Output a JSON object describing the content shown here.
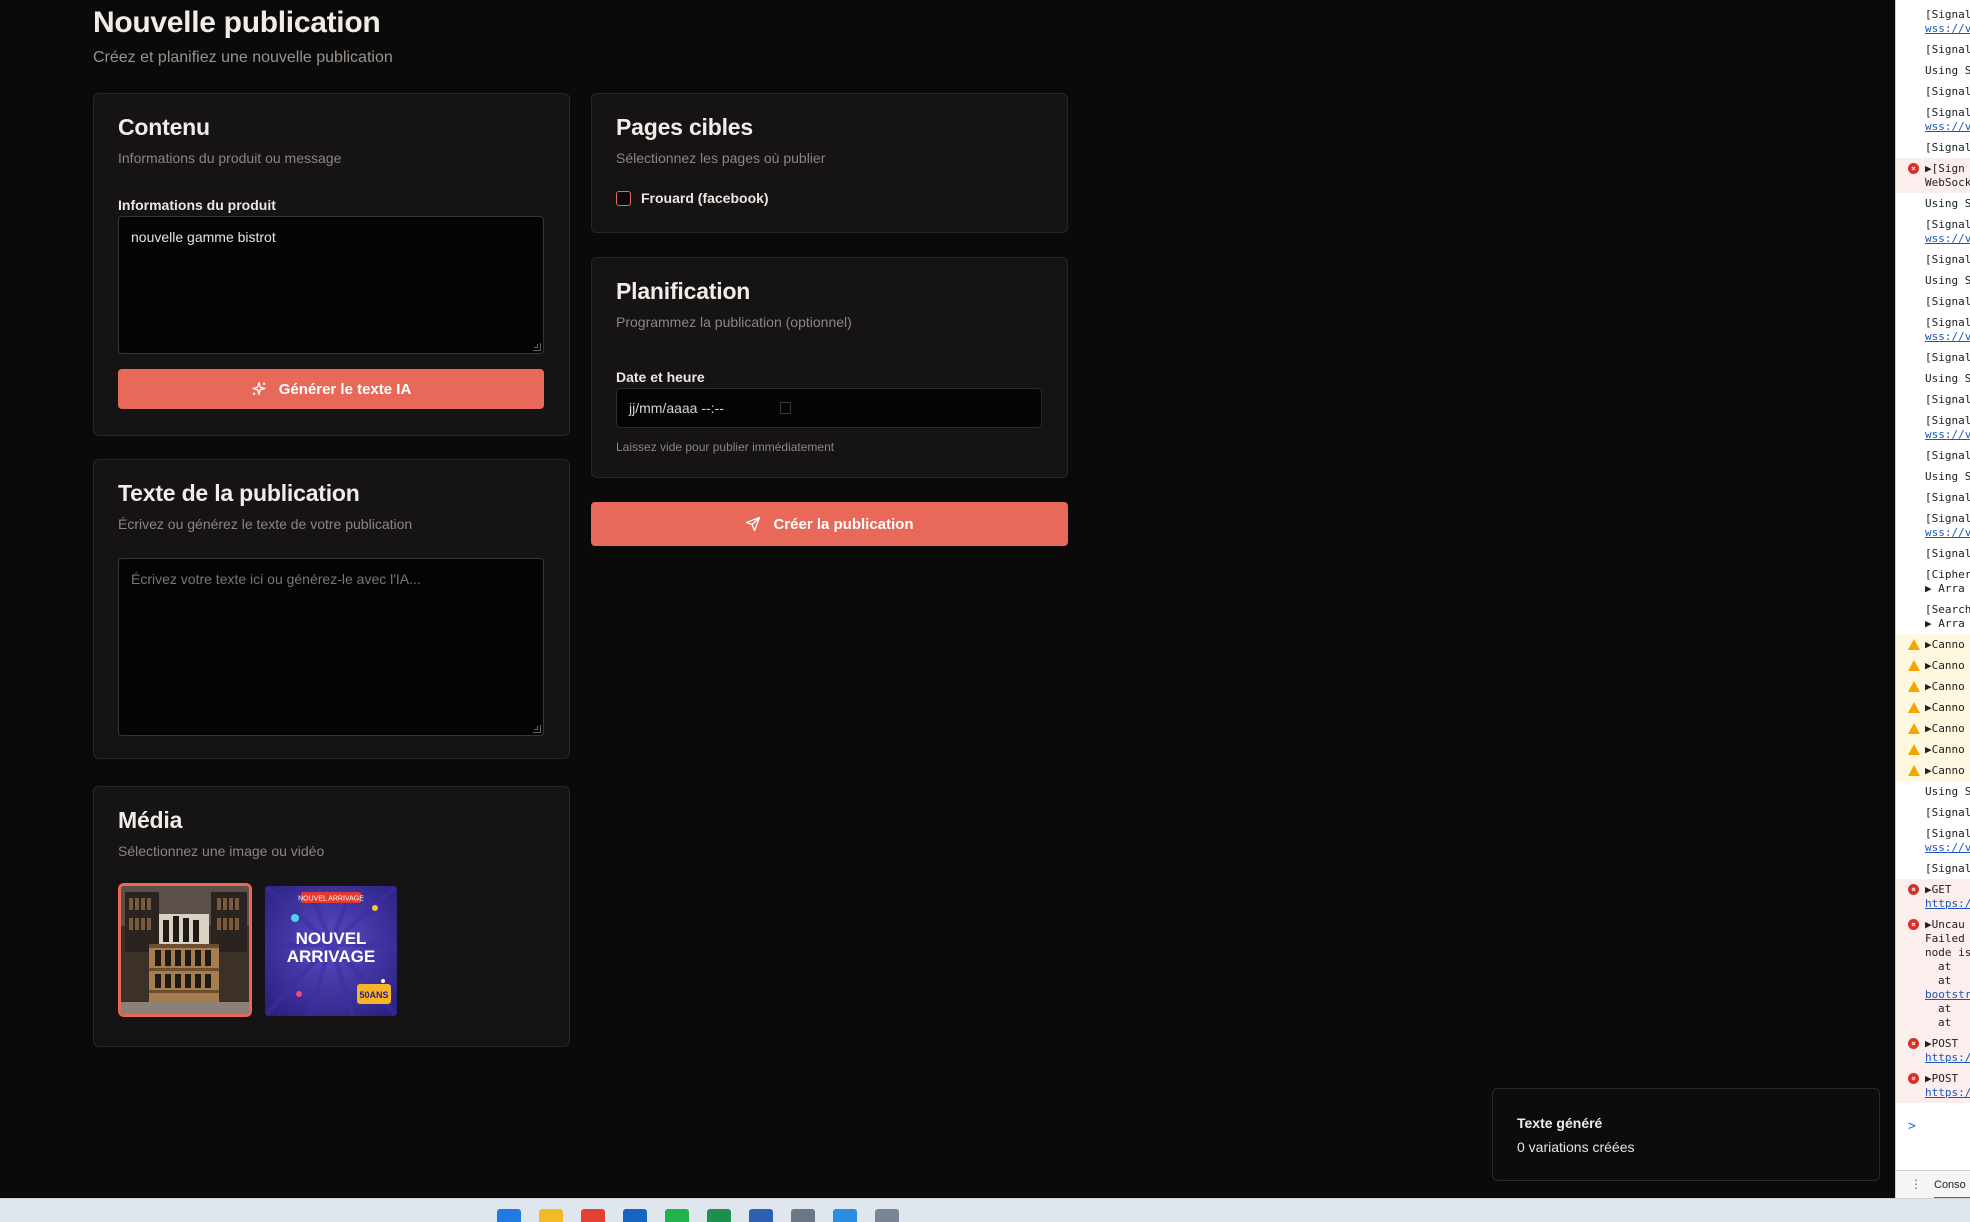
{
  "page": {
    "title": "Nouvelle publication",
    "subtitle": "Créez et planifiez une nouvelle publication"
  },
  "content_card": {
    "title": "Contenu",
    "subtitle": "Informations du produit ou message",
    "field_label": "Informations du produit",
    "field_value": "nouvelle gamme bistrot",
    "generate_button": "Générer le texte IA"
  },
  "text_card": {
    "title": "Texte de la publication",
    "subtitle": "Écrivez ou générez le texte de votre publication",
    "placeholder": "Écrivez votre texte ici ou générez-le avec l'IA..."
  },
  "media_card": {
    "title": "Média",
    "subtitle": "Sélectionnez une image ou vidéo",
    "thumbnails": [
      {
        "name": "store-display-photo",
        "selected": true
      },
      {
        "name": "nouvel-arrivage-poster",
        "selected": false,
        "text_main": "NOUVEL ARRIVAGE",
        "text_banner": "NOUVEL ARRIVAGE",
        "text_badge": "50ANS"
      }
    ]
  },
  "pages_card": {
    "title": "Pages cibles",
    "subtitle": "Sélectionnez les pages où publier",
    "pages": [
      {
        "label": "Frouard (facebook)",
        "checked": false
      }
    ]
  },
  "schedule_card": {
    "title": "Planification",
    "subtitle": "Programmez la publication (optionnel)",
    "field_label": "Date et heure",
    "date_placeholder": "jj/mm/aaaa --:--",
    "hint": "Laissez vide pour publier immédiatement"
  },
  "create_button": "Créer la publication",
  "toast": {
    "title": "Texte généré",
    "description": "0 variations créées"
  },
  "devtools": {
    "lines": [
      {
        "kind": "info",
        "text": "[Signal",
        "sub": "wss://v"
      },
      {
        "kind": "info",
        "text": "[Signal"
      },
      {
        "kind": "info",
        "text": "Using S"
      },
      {
        "kind": "info",
        "text": "[Signal"
      },
      {
        "kind": "info",
        "text": "[Signal",
        "sub": "wss://v"
      },
      {
        "kind": "info",
        "text": "[Signal"
      },
      {
        "kind": "error",
        "text": "▶[Sign",
        "sub": "WebSock"
      },
      {
        "kind": "info",
        "text": "Using S"
      },
      {
        "kind": "info",
        "text": "[Signal",
        "sub": "wss://v"
      },
      {
        "kind": "info",
        "text": "[Signal"
      },
      {
        "kind": "info",
        "text": "Using S"
      },
      {
        "kind": "info",
        "text": "[Signal"
      },
      {
        "kind": "info",
        "text": "[Signal",
        "sub": "wss://v"
      },
      {
        "kind": "info",
        "text": "[Signal"
      },
      {
        "kind": "info",
        "text": "Using S"
      },
      {
        "kind": "info",
        "text": "[Signal"
      },
      {
        "kind": "info",
        "text": "[Signal",
        "sub": "wss://v"
      },
      {
        "kind": "info",
        "text": "[Signal"
      },
      {
        "kind": "info",
        "text": "Using S"
      },
      {
        "kind": "info",
        "text": "[Signal"
      },
      {
        "kind": "info",
        "text": "[Signal",
        "sub": "wss://v"
      },
      {
        "kind": "info",
        "text": "[Signal"
      },
      {
        "kind": "info",
        "text": "[Cipher",
        "sub": "▶ Arra"
      },
      {
        "kind": "info",
        "text": "[Search",
        "sub": "▶ Arra"
      },
      {
        "kind": "warn",
        "text": "▶Canno"
      },
      {
        "kind": "warn",
        "text": "▶Canno"
      },
      {
        "kind": "warn",
        "text": "▶Canno"
      },
      {
        "kind": "warn",
        "text": "▶Canno"
      },
      {
        "kind": "warn",
        "text": "▶Canno"
      },
      {
        "kind": "warn",
        "text": "▶Canno"
      },
      {
        "kind": "warn",
        "text": "▶Canno"
      },
      {
        "kind": "info",
        "text": "Using S"
      },
      {
        "kind": "info",
        "text": "[Signal"
      },
      {
        "kind": "info",
        "text": "[Signal",
        "sub": "wss://v"
      },
      {
        "kind": "info",
        "text": "[Signal"
      },
      {
        "kind": "error",
        "text": "▶GET",
        "sub": "https:/"
      },
      {
        "kind": "error",
        "text": "▶Uncau",
        "extra": [
          "Failed",
          "node is",
          "at",
          "at",
          "bootstr",
          "at",
          "at"
        ]
      },
      {
        "kind": "error",
        "text": "▶POST",
        "sub": "https:/"
      },
      {
        "kind": "error",
        "text": "▶POST",
        "sub": "https:/"
      }
    ],
    "prompt": ">",
    "tab_label": "Conso"
  },
  "taskbar": {
    "icons": [
      {
        "name": "windows-start-icon",
        "color": "#1f7be0"
      },
      {
        "name": "file-explorer-icon",
        "color": "#f2b928"
      },
      {
        "name": "chrome-icon",
        "color": "#e34133"
      },
      {
        "name": "outlook-icon",
        "color": "#1564c0"
      },
      {
        "name": "whatsapp-icon",
        "color": "#22b14c"
      },
      {
        "name": "excel-icon",
        "color": "#1e8f4e"
      },
      {
        "name": "app-icon",
        "color": "#2e5fb0"
      },
      {
        "name": "settings-icon",
        "color": "#6b7785"
      },
      {
        "name": "store-icon",
        "color": "#2b8de2"
      },
      {
        "name": "settings-alt-icon",
        "color": "#7a8593"
      }
    ]
  }
}
